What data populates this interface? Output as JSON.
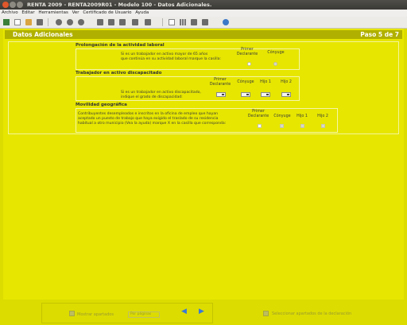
{
  "window": {
    "title": "RENTA 2009 - RENTA2009R01 - Modelo 100 - Datos Adicionales."
  },
  "menu": [
    "Archivo",
    "Editar",
    "Herramientas",
    "Ver",
    "Certificado de Usuario",
    "Ayuda"
  ],
  "header": {
    "title": "Datos Adicionales",
    "step": "Paso 5 de 7"
  },
  "sections": {
    "prolongacion": {
      "title": "Prolongación de la actividad laboral",
      "text_line1": "Si es un trabajador en activo mayor de 65 años",
      "text_line2": "que continúa en su actividad laboral marque la casilla:",
      "col_primer_line1": "Primer",
      "col_primer_line2": "Declarante",
      "col_conyuge": "Cónyuge"
    },
    "discapacitado": {
      "title": "Trabajador en activo discapacitado",
      "text_line1": "Si es un trabajador en activo discapacitado,",
      "text_line2": "indique el grado de discapacidad:",
      "col_primer_line1": "Primer",
      "col_primer_line2": "Declarante",
      "col_conyuge": "Cónyuge",
      "col_hijo1": "Hijo 1",
      "col_hijo2": "Hijo 2"
    },
    "movilidad": {
      "title": "Movilidad geográfica",
      "text_line1": "Contribuyentes desempleados e inscritos en la oficina de empleo que hayan",
      "text_line2": "aceptado un puesto de trabajo que haya exigido el traslado de su residencia",
      "text_line3": "habitual a otro municipio (Vea la ayuda) marque X en la casilla que corresponda:",
      "col_primer_line1": "Primer",
      "col_primer_line2": "Declarante",
      "col_conyuge": "Cónyuge",
      "col_hijo1": "Hijo 1",
      "col_hijo2": "Hijo 2"
    }
  },
  "footer": {
    "mostrar_label": "Mostrar apartados",
    "select_value": "Por páginas",
    "seleccionar_label": "Seleccionar apartados de la declaración"
  }
}
